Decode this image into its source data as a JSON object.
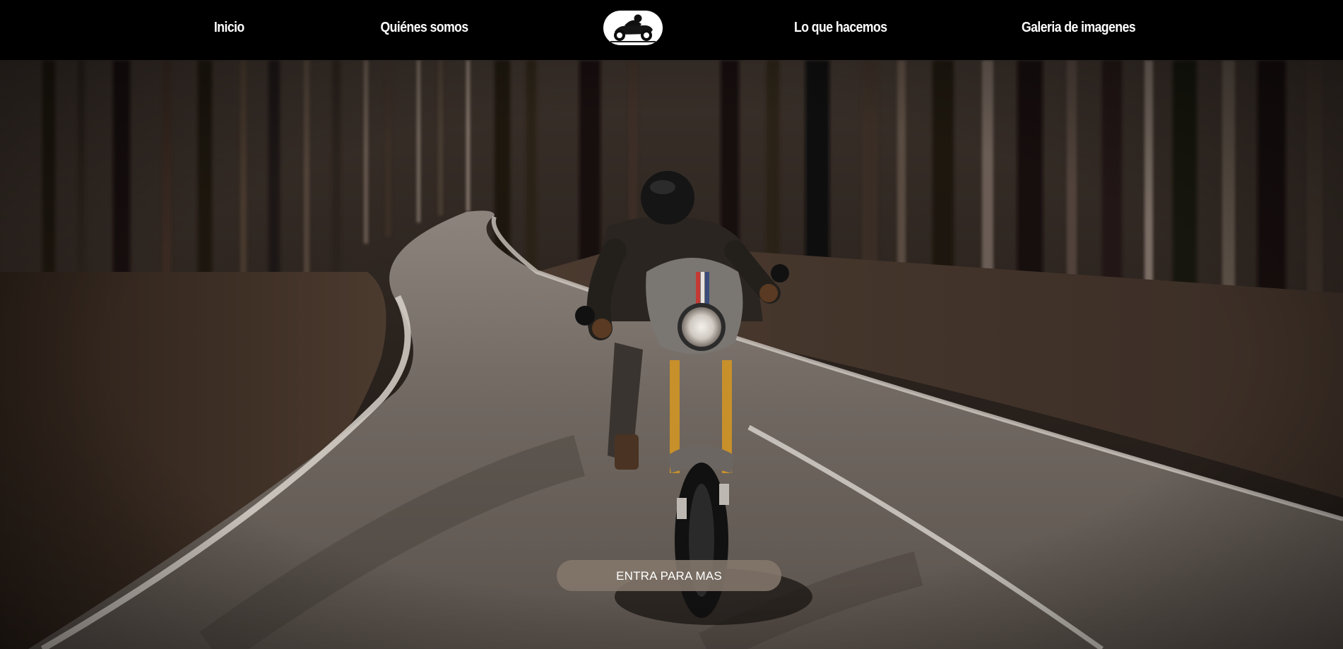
{
  "nav": {
    "links": [
      {
        "label": "Inicio"
      },
      {
        "label": "Quiénes somos"
      },
      {
        "label": "Lo que hacemos"
      },
      {
        "label": "Galeria de imagenes"
      }
    ],
    "logo_icon": "motorcycle-rider-icon"
  },
  "hero": {
    "cta_label": "ENTRA PARA MAS"
  },
  "colors": {
    "navbar_background": "#000000",
    "nav_text": "#ffffff",
    "cta_background": "#84776c",
    "cta_text": "#ffffff"
  }
}
